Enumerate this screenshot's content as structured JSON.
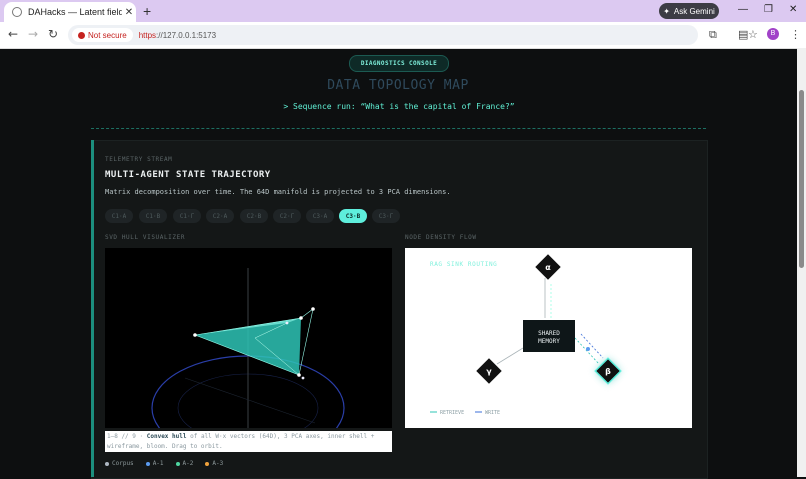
{
  "browser": {
    "tab_title": "DAHacks — Latent field",
    "new_tab": "+",
    "ask_gemini": "Ask Gemini",
    "not_secure": "Not secure",
    "url_scheme": "https",
    "url_rest": "://127.0.0.1:5173",
    "profile_initial": "B"
  },
  "page": {
    "badge": "DIAGNOSTICS CONSOLE",
    "title": "DATA TOPOLOGY MAP",
    "subtitle": "> Sequence run: “What is the capital of France?”"
  },
  "panel": {
    "kicker": "TELEMETRY STREAM",
    "heading": "MULTI-AGENT STATE TRAJECTORY",
    "description": "Matrix decomposition over time. The 64D manifold is projected to 3 PCA dimensions.",
    "pills": [
      "C1·A",
      "C1·B",
      "C1·Γ",
      "C2·A",
      "C2·B",
      "C2·Γ",
      "C3·A",
      "C3·B",
      "C3·Γ"
    ],
    "active_pill": "C3·B"
  },
  "hull": {
    "title": "SVD HULL VISUALIZER",
    "caption_prefix": "1–8 // 9 · ",
    "caption_bold": "Convex hull",
    "caption_rest": " of all W·x vectors (64D), 3 PCA axes, inner shell + wireframe, bloom. Drag to orbit.",
    "legend": [
      {
        "label": "Corpus",
        "color": "#aeb7c2"
      },
      {
        "label": "A-1",
        "color": "#5b9bf0"
      },
      {
        "label": "A-2",
        "color": "#4fd6a0"
      },
      {
        "label": "A-3",
        "color": "#f0a23c"
      }
    ],
    "accent": "#2ec4b6"
  },
  "flow": {
    "title": "NODE DENSITY FLOW",
    "routing_label": "RAG SINK ROUTING",
    "center_line1": "SHARED",
    "center_line2": "MEMORY",
    "node_alpha": "α",
    "node_beta": "β",
    "node_gamma": "γ",
    "legend_retrieve": "RETRIEVE",
    "legend_write": "WRITE"
  }
}
